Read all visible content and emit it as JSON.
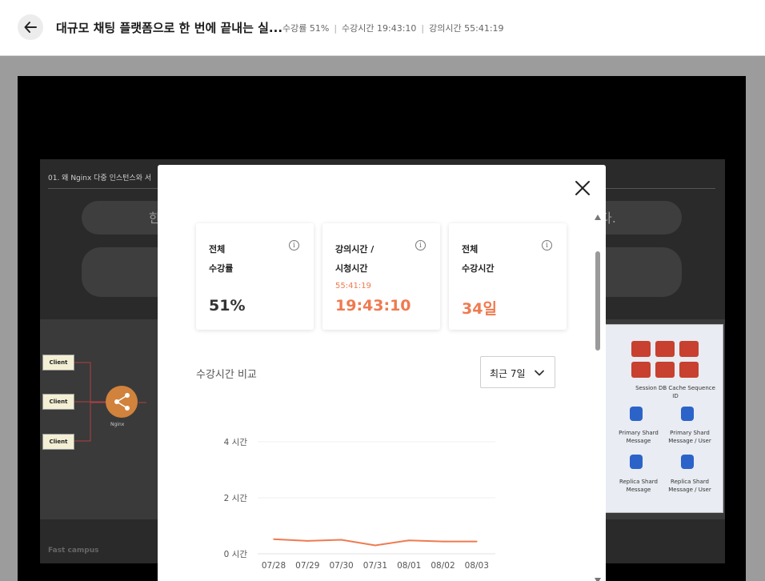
{
  "header": {
    "title": "대규모 채팅 플랫폼으로 한 번에 끝내는 실...",
    "progress_text": "수강률 51%",
    "watch_time_text": "수강시간 19:43:10",
    "lecture_time_text": "강의시간 55:41:19"
  },
  "slide": {
    "title": "01. 왜 Nginx 다중 인스턴스와 서",
    "pill_left_char": "한",
    "pill_right_char": "다.",
    "clients": [
      "Client",
      "Client",
      "Client"
    ],
    "nginx_label": "Nginx",
    "right_panel": {
      "cache_label": "Session DB Cache Sequence ID",
      "primary_message": "Primary Shard Message",
      "primary_message_user": "Primary Shard Message / User",
      "replica_message": "Replica Shard Message",
      "replica_message_user": "Replica Shard Message / User"
    },
    "logo_text": "Fast campus"
  },
  "modal": {
    "cards": [
      {
        "label_line1": "전체",
        "label_line2": "수강률",
        "sub": "",
        "value": "51%"
      },
      {
        "label_line1": "강의시간 /",
        "label_line2": "시청시간",
        "sub": "55:41:19",
        "value": "19:43:10"
      },
      {
        "label_line1": "전체",
        "label_line2": "수강시간",
        "sub": "",
        "value": "34일"
      }
    ],
    "info_glyph": "i",
    "compare_title": "수강시간 비교",
    "range_select": "최근 7일"
  },
  "chart_data": {
    "type": "line",
    "categories": [
      "07/28",
      "07/29",
      "07/30",
      "07/31",
      "08/01",
      "08/02",
      "08/03"
    ],
    "y_tick_labels": [
      "4 시간",
      "2 시간",
      "0 시간"
    ],
    "y_ticks": [
      4,
      2,
      0
    ],
    "ylim": [
      0,
      4.5
    ],
    "series": [
      {
        "values": [
          0.52,
          0.46,
          0.5,
          0.3,
          0.48,
          0.44,
          0.44
        ],
        "color": "#ef7a50"
      }
    ],
    "grid": true
  },
  "colors": {
    "accent": "#ef7a50",
    "text_dark": "#333333"
  }
}
